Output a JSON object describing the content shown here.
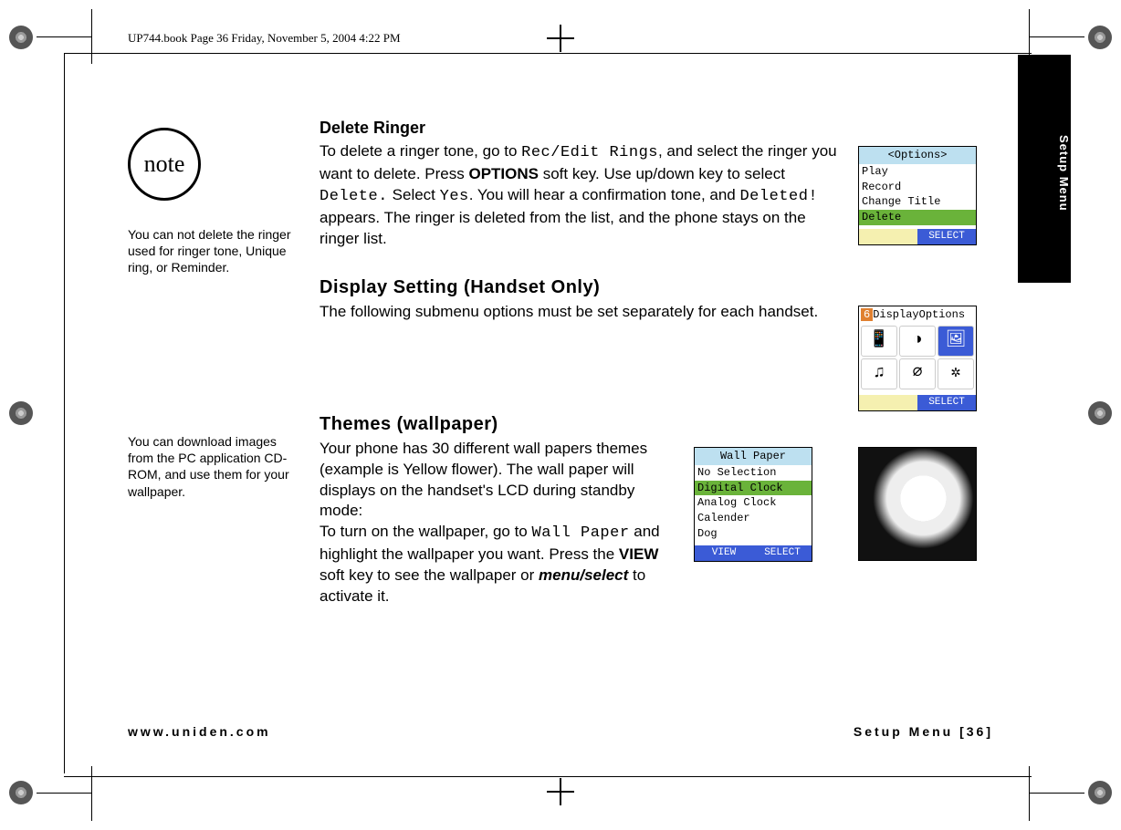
{
  "header": "UP744.book  Page 36  Friday, November 5, 2004  4:22 PM",
  "side_tab": "Setup Menu",
  "note_label": "note",
  "note1": "You can not delete the ringer used for ringer tone, Unique ring, or Reminder.",
  "note2": "You can download images from the PC application CD-ROM, and use them for your wallpaper.",
  "section1": {
    "heading": "Delete Ringer",
    "pre": "To delete a ringer tone, go to ",
    "lcd1": "Rec/Edit Rings",
    "mid1": ", and select the ringer you want to delete. Press ",
    "bold1": "OPTIONS",
    "mid2": " soft key. Use up/down key to select ",
    "lcd2": "Delete.",
    "mid3": " Select ",
    "lcd3": "Yes",
    "mid4": ". You will hear a confirmation tone, and ",
    "lcd4": "Deleted!",
    "post": " appears. The ringer is deleted from the list, and the phone stays on the ringer list."
  },
  "section2": {
    "heading": "Display Setting (Handset Only)",
    "body": "The following submenu options must be set separately for each handset."
  },
  "section3": {
    "heading": "Themes (wallpaper)",
    "p1": "Your phone has 30 different wall papers themes (example is Yellow flower). The wall paper will displays on the handset's LCD during standby mode:",
    "p2a": "To turn on the wallpaper, go to ",
    "lcd": "Wall Paper",
    "p2b": " and highlight the wallpaper you want. Press the ",
    "bold": "VIEW",
    "p2c": " soft key to see the wallpaper or ",
    "italic": "menu/select",
    "p2d": " to activate it."
  },
  "screen_options": {
    "title": "<Options>",
    "items": [
      "Play",
      "Record",
      "Change Title",
      "Delete"
    ],
    "highlight_index": 3,
    "soft_left": "",
    "soft_right": "SELECT"
  },
  "screen_display": {
    "tag": "6",
    "title": "DisplayOptions",
    "soft_right": "SELECT"
  },
  "screen_wallpaper": {
    "title": "Wall Paper",
    "items": [
      "No Selection",
      "Digital Clock",
      "Analog Clock",
      "Calender",
      "Dog"
    ],
    "highlight_index": 1,
    "soft_left": "VIEW",
    "soft_right": "SELECT"
  },
  "footer": {
    "left": "www.uniden.com",
    "right": "Setup Menu [36]"
  }
}
